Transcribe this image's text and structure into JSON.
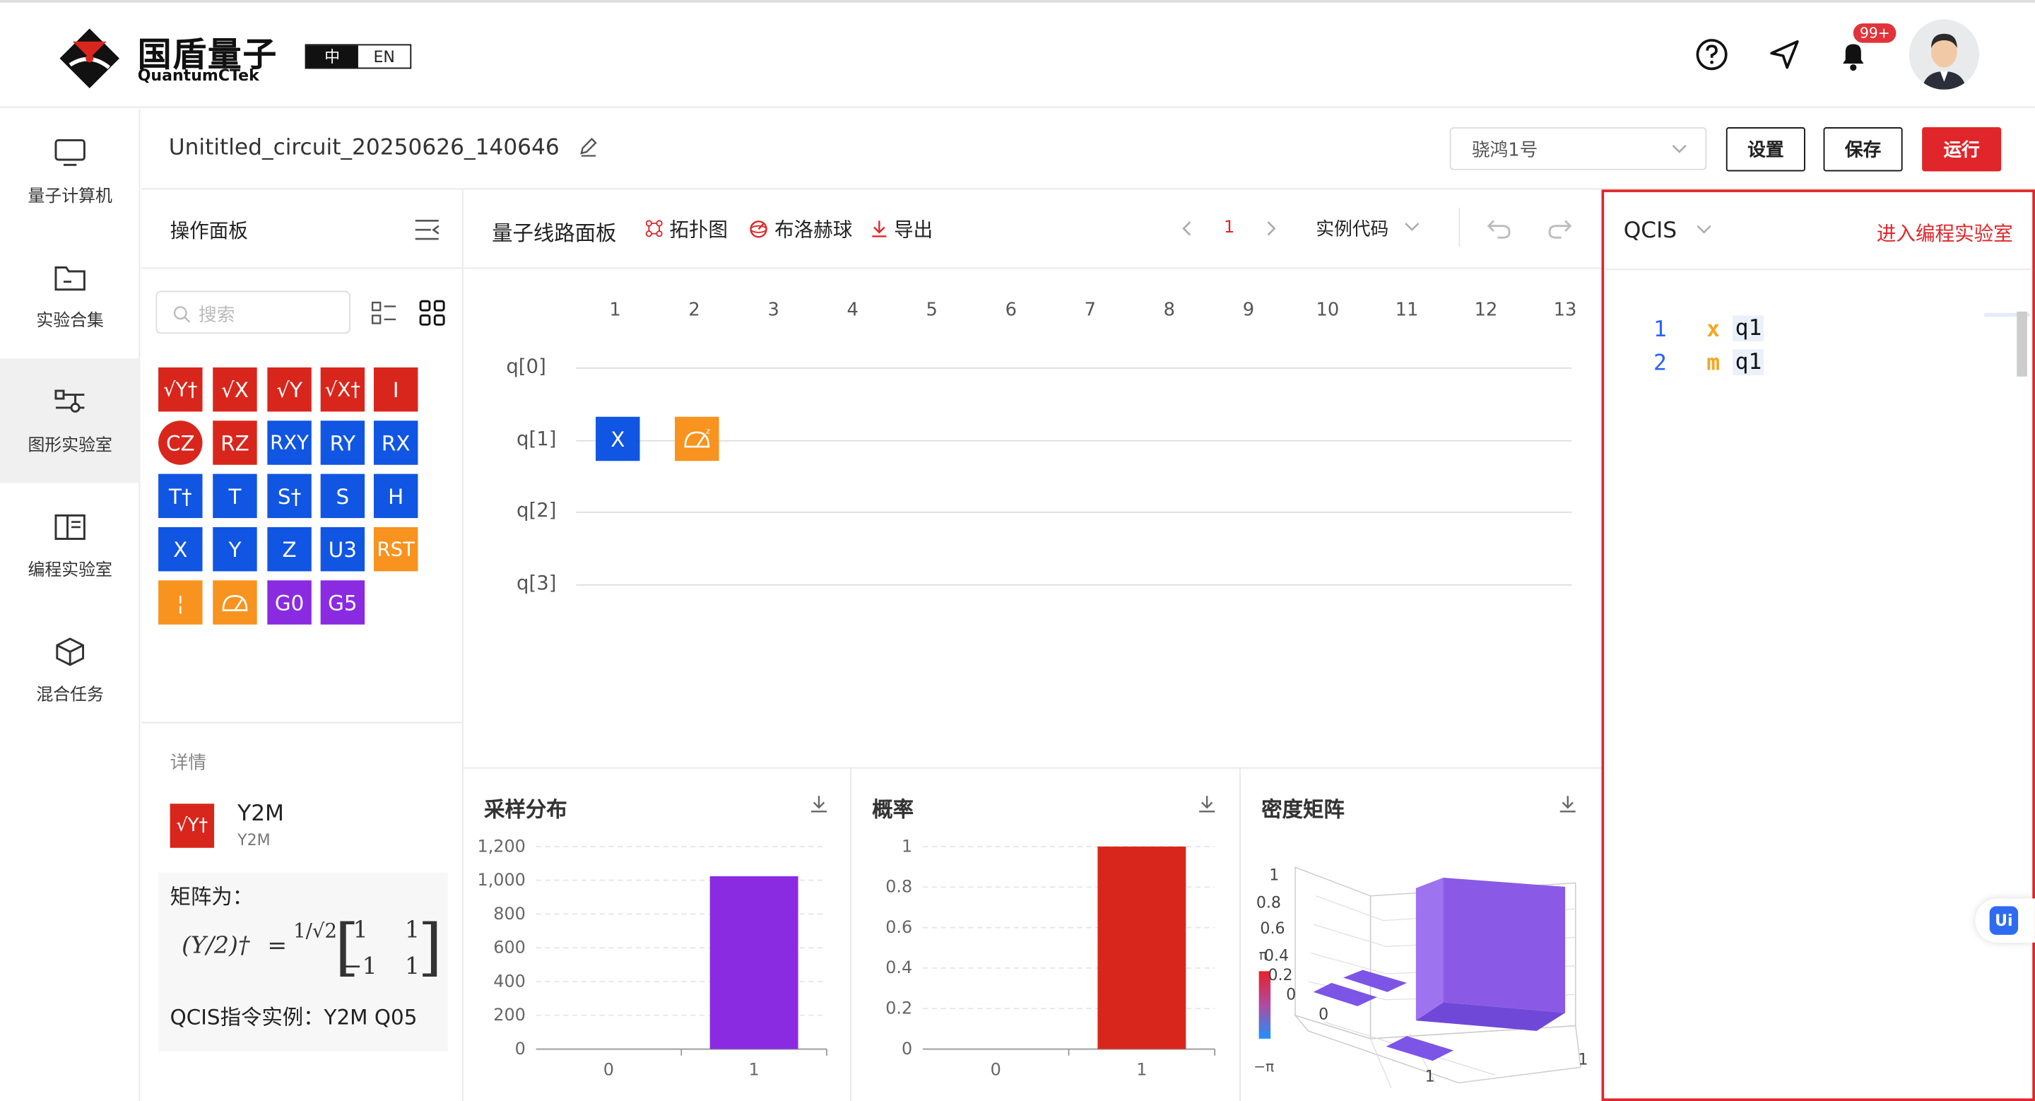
{
  "header": {
    "logo_title": "国盾量子",
    "logo_subtitle": "QuantumCTek",
    "lang_zh": "中",
    "lang_en": "EN",
    "notification_count": "99+"
  },
  "sidebar": {
    "items": [
      {
        "label": "量子计算机",
        "icon": "monitor-icon"
      },
      {
        "label": "实验合集",
        "icon": "folder-icon"
      },
      {
        "label": "图形实验室",
        "icon": "circuit-icon"
      },
      {
        "label": "编程实验室",
        "icon": "book-icon"
      },
      {
        "label": "混合任务",
        "icon": "cube-icon"
      }
    ]
  },
  "titlebar": {
    "circuit_name": "Unititled_circuit_20250626_140646",
    "device": "骁鸿1号",
    "settings": "设置",
    "save": "保存",
    "run": "运行"
  },
  "ops": {
    "title": "操作面板",
    "search_placeholder": "搜索",
    "gates": [
      {
        "label": "√Y†",
        "color": "r"
      },
      {
        "label": "√X",
        "color": "r"
      },
      {
        "label": "√Y",
        "color": "r"
      },
      {
        "label": "√X†",
        "color": "r"
      },
      {
        "label": "I",
        "color": "r"
      },
      {
        "label": "CZ",
        "color": "r"
      },
      {
        "label": "RZ",
        "color": "r"
      },
      {
        "label": "RXY",
        "color": "b"
      },
      {
        "label": "RY",
        "color": "b"
      },
      {
        "label": "RX",
        "color": "b"
      },
      {
        "label": "T†",
        "color": "b"
      },
      {
        "label": "T",
        "color": "b"
      },
      {
        "label": "S†",
        "color": "b"
      },
      {
        "label": "S",
        "color": "b"
      },
      {
        "label": "H",
        "color": "b"
      },
      {
        "label": "X",
        "color": "b"
      },
      {
        "label": "Y",
        "color": "b"
      },
      {
        "label": "Z",
        "color": "b"
      },
      {
        "label": "U3",
        "color": "b"
      },
      {
        "label": "RST",
        "color": "o"
      },
      {
        "label": "¦",
        "color": "o"
      },
      {
        "label": "M",
        "color": "o"
      },
      {
        "label": "G0",
        "color": "p"
      },
      {
        "label": "G5",
        "color": "p"
      }
    ],
    "details_title": "详情",
    "detail_name": "Y2M",
    "detail_sub": "Y2M",
    "matrix_label": "矩阵为：",
    "matrix_lhs": "(Y/2)†",
    "matrix_frac": "1/√2",
    "matrix": [
      "1",
      "1",
      "−1",
      "1"
    ],
    "example": "QCIS指令实例：Y2M Q05"
  },
  "circuit": {
    "title": "量子线路面板",
    "topology": "拓扑图",
    "bloch": "布洛赫球",
    "export": "导出",
    "page": "1",
    "examples": "实例代码",
    "columns": [
      "1",
      "2",
      "3",
      "4",
      "5",
      "6",
      "7",
      "8",
      "9",
      "10",
      "11",
      "12",
      "13"
    ],
    "qubits": [
      "q[0]",
      "q[1]",
      "q[2]",
      "q[3]"
    ],
    "placed_gate_x": "X"
  },
  "charts": {
    "sampling_title": "采样分布",
    "probability_title": "概率",
    "density_title": "密度矩阵"
  },
  "chart_data": [
    {
      "type": "bar",
      "title": "采样分布",
      "categories": [
        "0",
        "1"
      ],
      "values": [
        0,
        1024
      ],
      "ylim": [
        0,
        1200
      ],
      "yticks": [
        "0",
        "200",
        "400",
        "600",
        "800",
        "1,000",
        "1,200"
      ],
      "color": "#8a2be2"
    },
    {
      "type": "bar",
      "title": "概率",
      "categories": [
        "0",
        "1"
      ],
      "values": [
        0,
        1
      ],
      "ylim": [
        0,
        1
      ],
      "yticks": [
        "0",
        "0.2",
        "0.4",
        "0.6",
        "0.8",
        "1"
      ],
      "color": "#d9261c"
    },
    {
      "type": "bar3d",
      "title": "密度矩阵",
      "zticks": [
        "0",
        "0.2",
        "0.4",
        "0.6",
        "0.8",
        "1"
      ],
      "axis_labels": [
        "0",
        "1",
        "1"
      ],
      "phase_min": "−π",
      "phase_mid": "π"
    }
  ],
  "code": {
    "language": "QCIS",
    "enter_lab": "进入编程实验室",
    "lines": [
      {
        "num": "1",
        "op": "x",
        "arg": "q1"
      },
      {
        "num": "2",
        "op": "m",
        "arg": "q1"
      }
    ]
  },
  "floating": {
    "ui_badge": "Ui"
  }
}
